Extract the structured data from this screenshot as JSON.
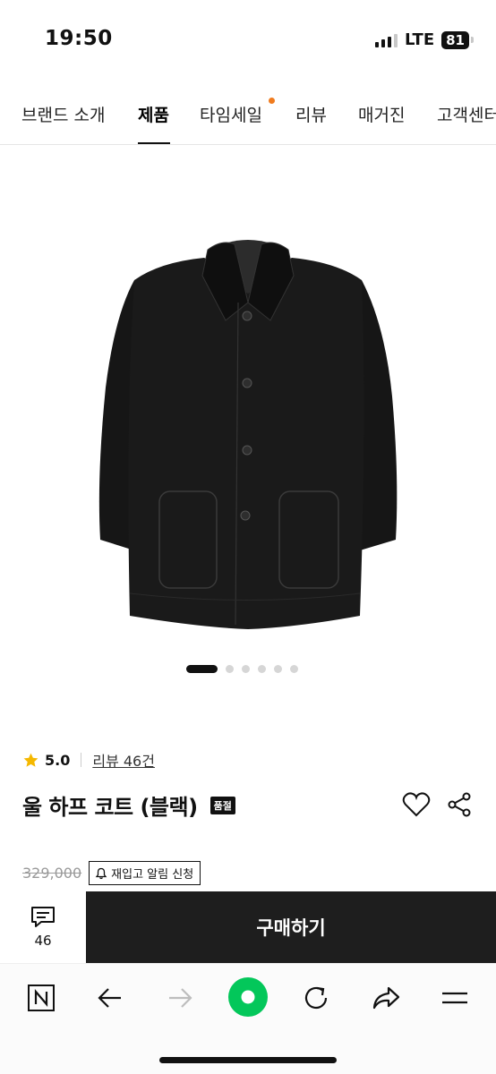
{
  "status_bar": {
    "time": "19:50",
    "network": "LTE",
    "battery": "81"
  },
  "nav": {
    "tabs": [
      {
        "label": "브랜드 소개"
      },
      {
        "label": "제품"
      },
      {
        "label": "타임세일"
      },
      {
        "label": "리뷰"
      },
      {
        "label": "매거진"
      },
      {
        "label": "고객센터"
      }
    ],
    "active_tab": "제품",
    "notification_dot_color": "#f07b1e"
  },
  "product": {
    "image_icon": "black-wool-coat-image",
    "carousel_total": 6,
    "carousel_active": 1,
    "rating": "5.0",
    "review_link": "리뷰 46건",
    "title": "울 하프 코트 (블랙)",
    "soldout_badge": "품절",
    "original_price": "329,000",
    "restock_button": "재입고 알림 신청"
  },
  "purchase_bar": {
    "review_count": "46",
    "buy_label": "구매하기"
  },
  "browser_toolbar": {
    "icons": [
      "naver-n-icon",
      "back-arrow-icon",
      "forward-arrow-icon",
      "green-home-icon",
      "refresh-icon",
      "share-icon",
      "menu-icon"
    ],
    "accent": "#03c75a"
  }
}
